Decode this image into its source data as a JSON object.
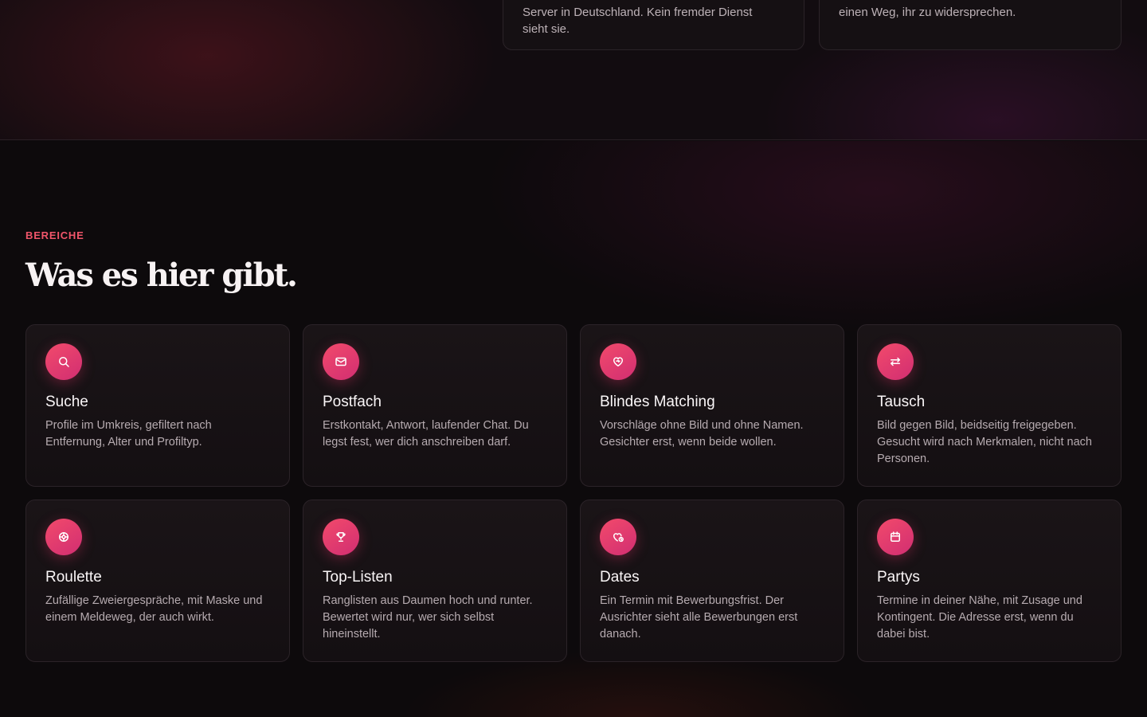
{
  "top": {
    "card_left_text": "Server in Deutschland. Kein fremder Dienst sieht sie.",
    "card_right_text": "einen Weg, ihr zu widersprechen."
  },
  "section": {
    "eyebrow": "BEREICHE",
    "title": "Was es hier gibt."
  },
  "cards": [
    {
      "title": "Suche",
      "text": "Profile im Umkreis, gefiltert nach Entfernung, Alter und Profiltyp.",
      "icon": "search-icon"
    },
    {
      "title": "Postfach",
      "text": "Erstkontakt, Antwort, laufender Chat. Du legst fest, wer dich anschreiben darf.",
      "icon": "mail-icon"
    },
    {
      "title": "Blindes Matching",
      "text": "Vorschläge ohne Bild und ohne Namen. Gesichter erst, wenn beide wollen.",
      "icon": "heart-icon"
    },
    {
      "title": "Tausch",
      "text": "Bild gegen Bild, beidseitig freigegeben. Gesucht wird nach Merkmalen, nicht nach Personen.",
      "icon": "swap-icon"
    },
    {
      "title": "Roulette",
      "text": "Zufällige Zweiergespräche, mit Maske und einem Meldeweg, der auch wirkt.",
      "icon": "roulette-icon"
    },
    {
      "title": "Top-Listen",
      "text": "Ranglisten aus Daumen hoch und runter. Bewertet wird nur, wer sich selbst hineinstellt.",
      "icon": "trophy-icon"
    },
    {
      "title": "Dates",
      "text": "Ein Termin mit Bewerbungsfrist. Der Ausrichter sieht alle Bewerbungen erst danach.",
      "icon": "heart-clock-icon"
    },
    {
      "title": "Partys",
      "text": "Termine in deiner Nähe, mit Zusage und Kontingent. Die Adresse erst, wenn du dabei bist.",
      "icon": "calendar-icon"
    }
  ],
  "colors": {
    "accent": "#f0556a",
    "icon_gradient_start": "#f24a6b",
    "icon_gradient_end": "#d12e72",
    "background": "#0d0a0c"
  }
}
